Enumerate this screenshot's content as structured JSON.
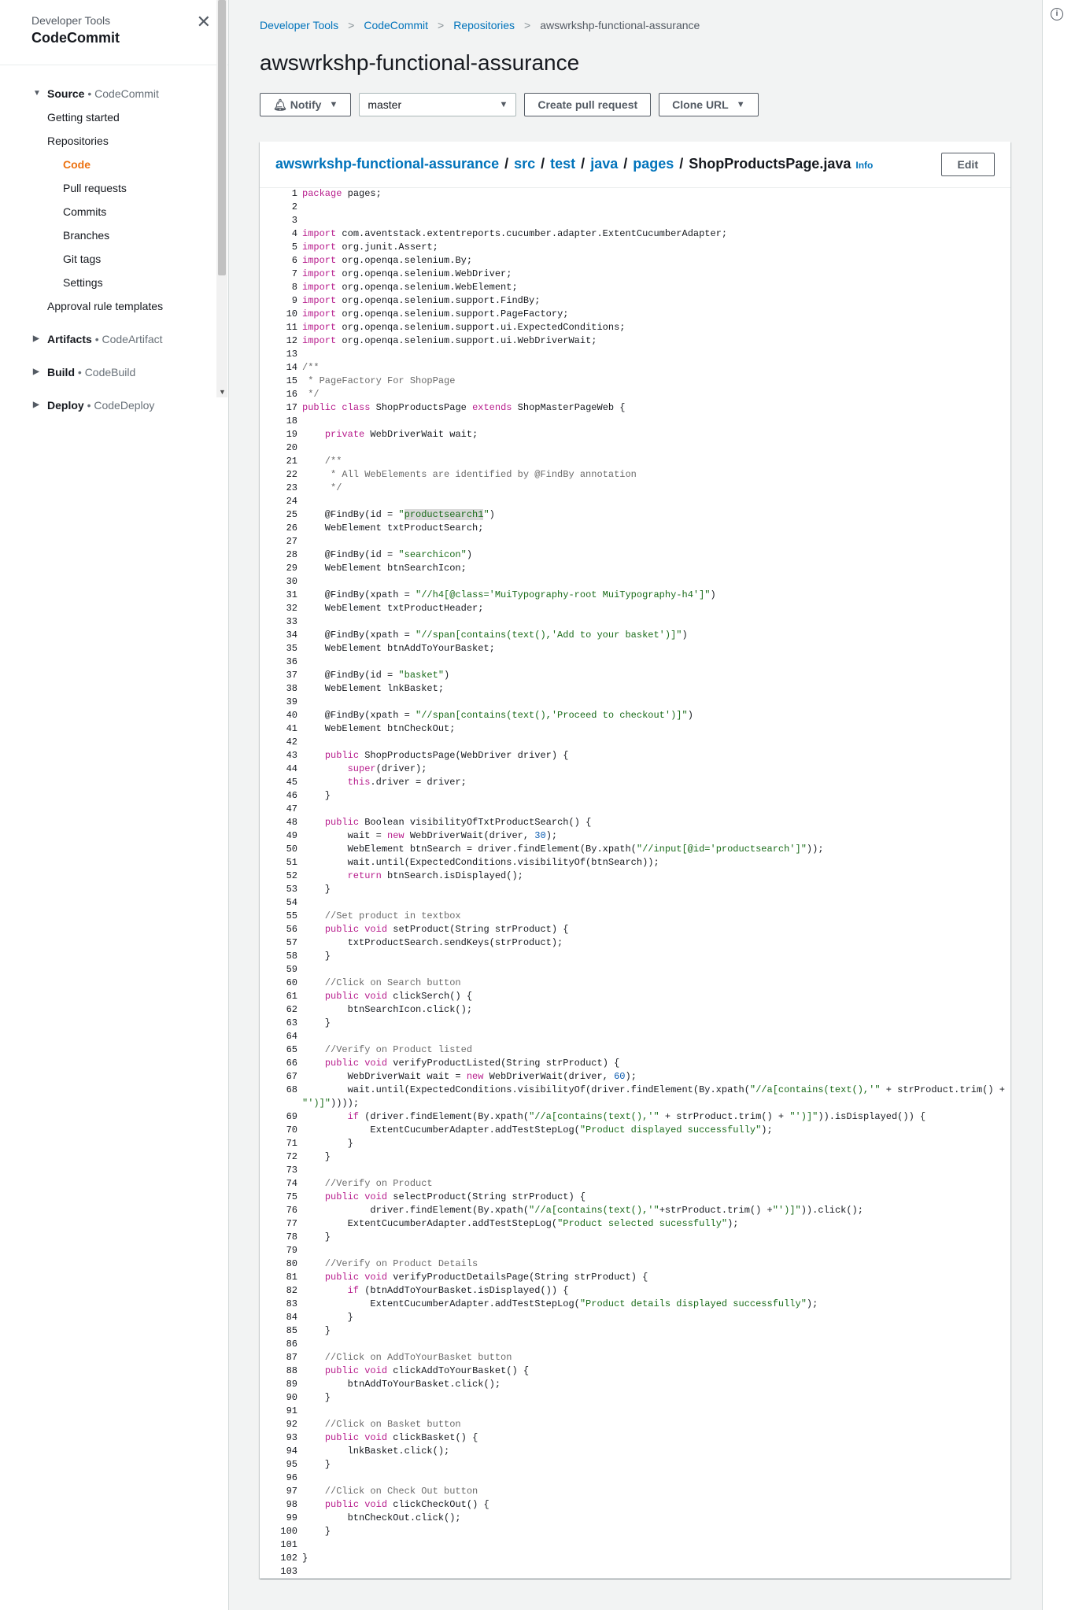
{
  "sidebar": {
    "kicker": "Developer Tools",
    "title": "CodeCommit",
    "close_icon": "close-icon",
    "sections": [
      {
        "name": "Source",
        "sub": "CodeCommit"
      },
      {
        "name": "Artifacts",
        "sub": "CodeArtifact"
      },
      {
        "name": "Build",
        "sub": "CodeBuild"
      },
      {
        "name": "Deploy",
        "sub": "CodeDeploy"
      }
    ],
    "items": {
      "getting_started": "Getting started",
      "repositories": "Repositories",
      "code": "Code",
      "pull_requests": "Pull requests",
      "commits": "Commits",
      "branches": "Branches",
      "git_tags": "Git tags",
      "settings": "Settings",
      "approval_rule_templates": "Approval rule templates"
    },
    "bullet": "•"
  },
  "breadcrumb": {
    "items": [
      "Developer Tools",
      "CodeCommit",
      "Repositories",
      "awswrkshp-functional-assurance"
    ]
  },
  "page_title": "awswrkshp-functional-assurance",
  "toolbar": {
    "notify_label": "Notify",
    "branch_value": "master",
    "create_pr_label": "Create pull request",
    "clone_url_label": "Clone URL"
  },
  "file": {
    "path": [
      "awswrkshp-functional-assurance",
      "src",
      "test",
      "java",
      "pages"
    ],
    "name": "ShopProductsPage.java",
    "info_label": "Info",
    "edit_label": "Edit",
    "slash": "/"
  },
  "code_lines": [
    "package pages;",
    "",
    "",
    "import com.aventstack.extentreports.cucumber.adapter.ExtentCucumberAdapter;",
    "import org.junit.Assert;",
    "import org.openqa.selenium.By;",
    "import org.openqa.selenium.WebDriver;",
    "import org.openqa.selenium.WebElement;",
    "import org.openqa.selenium.support.FindBy;",
    "import org.openqa.selenium.support.PageFactory;",
    "import org.openqa.selenium.support.ui.ExpectedConditions;",
    "import org.openqa.selenium.support.ui.WebDriverWait;",
    "",
    "/**",
    " * PageFactory For ShopPage",
    " */",
    "public class ShopProductsPage extends ShopMasterPageWeb {",
    "",
    "    private WebDriverWait wait;",
    "",
    "    /**",
    "     * All WebElements are identified by @FindBy annotation",
    "     */",
    "",
    "    @FindBy(id = \"productsearch1\")",
    "    WebElement txtProductSearch;",
    "",
    "    @FindBy(id = \"searchicon\")",
    "    WebElement btnSearchIcon;",
    "",
    "    @FindBy(xpath = \"//h4[@class='MuiTypography-root MuiTypography-h4']\")",
    "    WebElement txtProductHeader;",
    "",
    "    @FindBy(xpath = \"//span[contains(text(),'Add to your basket')]\")",
    "    WebElement btnAddToYourBasket;",
    "",
    "    @FindBy(id = \"basket\")",
    "    WebElement lnkBasket;",
    "",
    "    @FindBy(xpath = \"//span[contains(text(),'Proceed to checkout')]\")",
    "    WebElement btnCheckOut;",
    "",
    "    public ShopProductsPage(WebDriver driver) {",
    "        super(driver);",
    "        this.driver = driver;",
    "    }",
    "",
    "    public Boolean visibilityOfTxtProductSearch() {",
    "        wait = new WebDriverWait(driver, 30);",
    "        WebElement btnSearch = driver.findElement(By.xpath(\"//input[@id='productsearch']\"));",
    "        wait.until(ExpectedConditions.visibilityOf(btnSearch));",
    "        return btnSearch.isDisplayed();",
    "    }",
    "",
    "    //Set product in textbox",
    "    public void setProduct(String strProduct) {",
    "        txtProductSearch.sendKeys(strProduct);",
    "    }",
    "",
    "    //Click on Search button",
    "    public void clickSerch() {",
    "        btnSearchIcon.click();",
    "    }",
    "",
    "    //Verify on Product listed",
    "    public void verifyProductListed(String strProduct) {",
    "        WebDriverWait wait = new WebDriverWait(driver, 60);",
    "        wait.until(ExpectedConditions.visibilityOf(driver.findElement(By.xpath(\"//a[contains(text(),'\" + strProduct.trim() + \"')]\"))));",
    "        if (driver.findElement(By.xpath(\"//a[contains(text(),'\" + strProduct.trim() + \"')]\")).isDisplayed()) {",
    "            ExtentCucumberAdapter.addTestStepLog(\"Product displayed successfully\");",
    "        }",
    "    }",
    "",
    "    //Verify on Product",
    "    public void selectProduct(String strProduct) {",
    "            driver.findElement(By.xpath(\"//a[contains(text(),'\"+strProduct.trim() +\"')]\")).click();",
    "        ExtentCucumberAdapter.addTestStepLog(\"Product selected sucessfully\");",
    "    }",
    "",
    "    //Verify on Product Details",
    "    public void verifyProductDetailsPage(String strProduct) {",
    "        if (btnAddToYourBasket.isDisplayed()) {",
    "            ExtentCucumberAdapter.addTestStepLog(\"Product details displayed successfully\");",
    "        }",
    "    }",
    "",
    "    //Click on AddToYourBasket button",
    "    public void clickAddToYourBasket() {",
    "        btnAddToYourBasket.click();",
    "    }",
    "",
    "    //Click on Basket button",
    "    public void clickBasket() {",
    "        lnkBasket.click();",
    "    }",
    "",
    "    //Click on Check Out button",
    "    public void clickCheckOut() {",
    "        btnCheckOut.click();",
    "    }",
    "",
    "}",
    ""
  ],
  "highlight_text": "productsearch1",
  "colors": {
    "accent_orange": "#ec7211",
    "link_blue": "#0073bb",
    "keyword": "#b71c8c",
    "comment": "#6b6b6b",
    "string": "#1a6b1a"
  }
}
